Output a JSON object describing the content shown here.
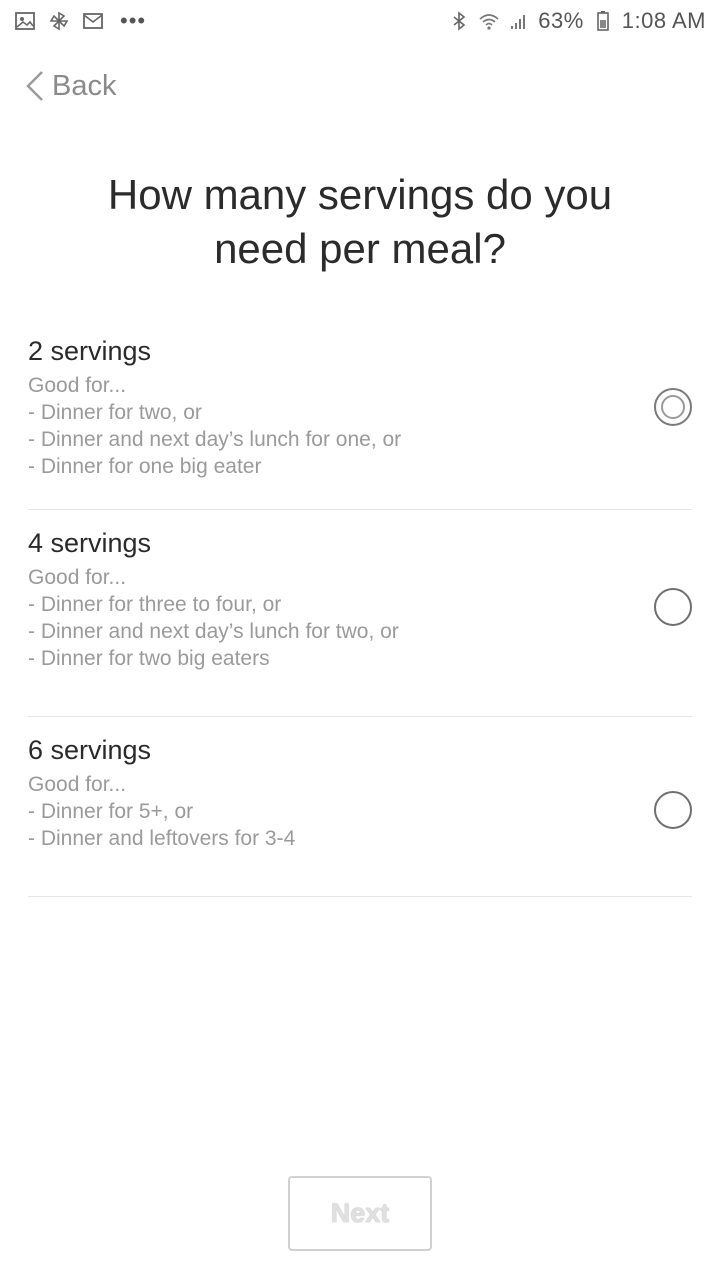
{
  "status_bar": {
    "icons_left": [
      "gallery-icon",
      "pinwheel-icon",
      "mail-icon"
    ],
    "more": "•••",
    "icons_right": [
      "bluetooth-icon",
      "wifi-icon",
      "signal-icon"
    ],
    "battery": "63%",
    "time": "1:08 AM"
  },
  "nav": {
    "back_label": "Back"
  },
  "page": {
    "title": "How many servings do you need per meal?"
  },
  "options": [
    {
      "title": "2 servings",
      "selected": true,
      "lines": [
        "Good for...",
        "- Dinner for two, or",
        "- Dinner and next day’s lunch for one, or",
        "- Dinner for one big eater"
      ]
    },
    {
      "title": "4 servings",
      "selected": false,
      "lines": [
        "Good for...",
        "- Dinner for three to four, or",
        "- Dinner and next day’s lunch for two, or",
        "- Dinner for two big eaters"
      ]
    },
    {
      "title": "6 servings",
      "selected": false,
      "lines": [
        "Good for...",
        "- Dinner for 5+, or",
        "- Dinner and leftovers for 3-4"
      ]
    }
  ],
  "footer": {
    "next_label": "Next"
  }
}
